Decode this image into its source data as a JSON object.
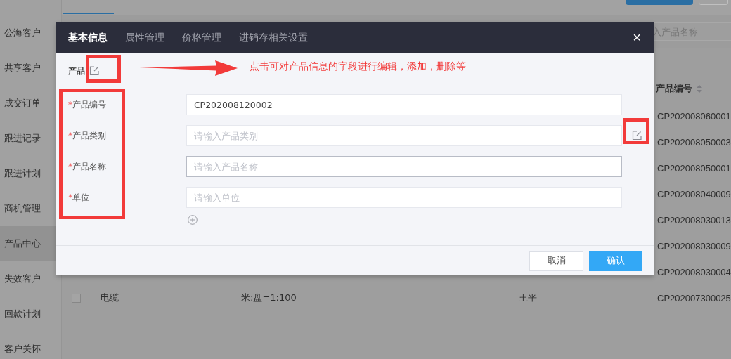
{
  "sidebar": {
    "items": [
      {
        "label": "公海客户",
        "selected": false
      },
      {
        "label": "共享客户",
        "selected": false
      },
      {
        "label": "成交订单",
        "selected": false
      },
      {
        "label": "跟进记录",
        "selected": false
      },
      {
        "label": "跟进计划",
        "selected": false
      },
      {
        "label": "商机管理",
        "selected": false
      },
      {
        "label": "产品中心",
        "selected": true
      },
      {
        "label": "失效客户",
        "selected": false
      },
      {
        "label": "回款计划",
        "selected": false
      },
      {
        "label": "客户关怀",
        "selected": false
      }
    ]
  },
  "search": {
    "placeholder": "入产品名称"
  },
  "table": {
    "header": "产品编号",
    "rows": [
      {
        "product_no": "CP202008060001"
      },
      {
        "product_no": "CP202008050003"
      },
      {
        "product_no": "CP202008050001"
      },
      {
        "product_no": "CP202008040009"
      },
      {
        "product_no": "CP202008030013"
      },
      {
        "product_no": "CP202008030009"
      },
      {
        "product_no": "CP202008030004"
      },
      {
        "checked": false,
        "column_2": "电缆",
        "column_3": "米:盘=1:100",
        "column_4": "王平",
        "product_no": "CP202007300025"
      }
    ]
  },
  "dialog": {
    "tabs": [
      {
        "label": "基本信息",
        "selected": true
      },
      {
        "label": "属性管理",
        "selected": false
      },
      {
        "label": "价格管理",
        "selected": false
      },
      {
        "label": "进销存相关设置",
        "selected": false
      }
    ],
    "close": "×",
    "section": "产品",
    "fields": [
      {
        "label": "产品编号",
        "required": "*",
        "value": "CP202008120002",
        "focused": false
      },
      {
        "label": "产品类别",
        "required": "*",
        "placeholder": "请输入产品类别",
        "focused": false,
        "editable": true
      },
      {
        "label": "产品名称",
        "required": "*",
        "placeholder": "请输入产品名称",
        "focused": true
      },
      {
        "label": "单位",
        "required": "*",
        "placeholder": "请输入单位",
        "focused": false
      }
    ],
    "buttons": [
      {
        "label": "取消",
        "kind": "secondary"
      },
      {
        "label": "确认",
        "kind": "primary"
      }
    ]
  },
  "annotation": {
    "text": "点击可对产品信息的字段进行编辑，添加，删除等"
  }
}
